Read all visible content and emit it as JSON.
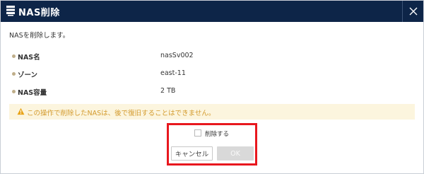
{
  "dialog": {
    "title": "NAS削除",
    "title_icon": "server-icon",
    "close_icon": "close-icon"
  },
  "message": "NASを削除します。",
  "details": [
    {
      "label": "NAS名",
      "value": "nasSv002"
    },
    {
      "label": "ゾーン",
      "value": "east-11"
    },
    {
      "label": "NAS容量",
      "value": "2 TB"
    }
  ],
  "warning": {
    "icon": "warning-icon",
    "text": "この操作で削除したNASは、後で復旧することはできません。"
  },
  "confirm": {
    "checkbox_label": "削除する",
    "checked": false
  },
  "buttons": {
    "cancel_label": "キャンセル",
    "ok_label": "OK",
    "ok_enabled": false
  },
  "colors": {
    "titlebar": "#0d2548",
    "warning_bg": "#fcf5de",
    "warning_text": "#d39a2c",
    "highlight": "#e8171e"
  }
}
